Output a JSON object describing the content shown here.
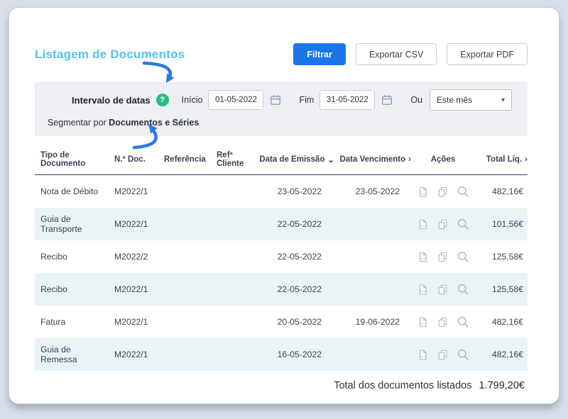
{
  "page": {
    "title": "Listagem de Documentos"
  },
  "toolbar": {
    "filter_label": "Filtrar",
    "export_csv_label": "Exportar CSV",
    "export_pdf_label": "Exportar PDF"
  },
  "filters": {
    "date_range_label": "Intervalo de datas",
    "start_label": "Início",
    "start_value": "01-05-2022",
    "end_label": "Fim",
    "end_value": "31-05-2022",
    "or_label": "Ou",
    "period_selected": "Este mês",
    "segment_prefix": "Segmentar por",
    "segment_value": "Documentos e Séries"
  },
  "icons": {
    "help": "?",
    "sort_down": "⌄",
    "chevron_right": "›",
    "select_caret": "▾"
  },
  "table": {
    "headers": [
      "Tipo de Documento",
      "N.º Doc.",
      "Referência",
      "Refª Cliente",
      "Data de Emissão",
      "Data Vencimento",
      "Ações",
      "Total Líq."
    ],
    "rows": [
      {
        "tipo": "Nota de Débito",
        "num": "M2022/1",
        "referencia": "",
        "ref_cliente": "",
        "emissao": "23-05-2022",
        "vencimento": "23-05-2022",
        "total": "482,16€"
      },
      {
        "tipo": "Guia de Transporte",
        "num": "M2022/1",
        "referencia": "",
        "ref_cliente": "",
        "emissao": "22-05-2022",
        "vencimento": "",
        "total": "101,56€"
      },
      {
        "tipo": "Recibo",
        "num": "M2022/2",
        "referencia": "",
        "ref_cliente": "",
        "emissao": "22-05-2022",
        "vencimento": "",
        "total": "125,58€"
      },
      {
        "tipo": "Recibo",
        "num": "M2022/1",
        "referencia": "",
        "ref_cliente": "",
        "emissao": "22-05-2022",
        "vencimento": "",
        "total": "125,58€"
      },
      {
        "tipo": "Fatura",
        "num": "M2022/1",
        "referencia": "",
        "ref_cliente": "",
        "emissao": "20-05-2022",
        "vencimento": "19-06-2022",
        "total": "482,16€"
      },
      {
        "tipo": "Guia de Remessa",
        "num": "M2022/1",
        "referencia": "",
        "ref_cliente": "",
        "emissao": "16-05-2022",
        "vencimento": "",
        "total": "482,16€"
      }
    ]
  },
  "footer": {
    "total_label": "Total dos documentos listados",
    "total_value": "1.799,20€"
  },
  "colors": {
    "primary_blue": "#1b74e8",
    "title_blue": "#53c1ef",
    "help_green": "#2bbd82",
    "arrow_blue": "#2b7ce0",
    "row_alt": "#e9f3f6"
  }
}
